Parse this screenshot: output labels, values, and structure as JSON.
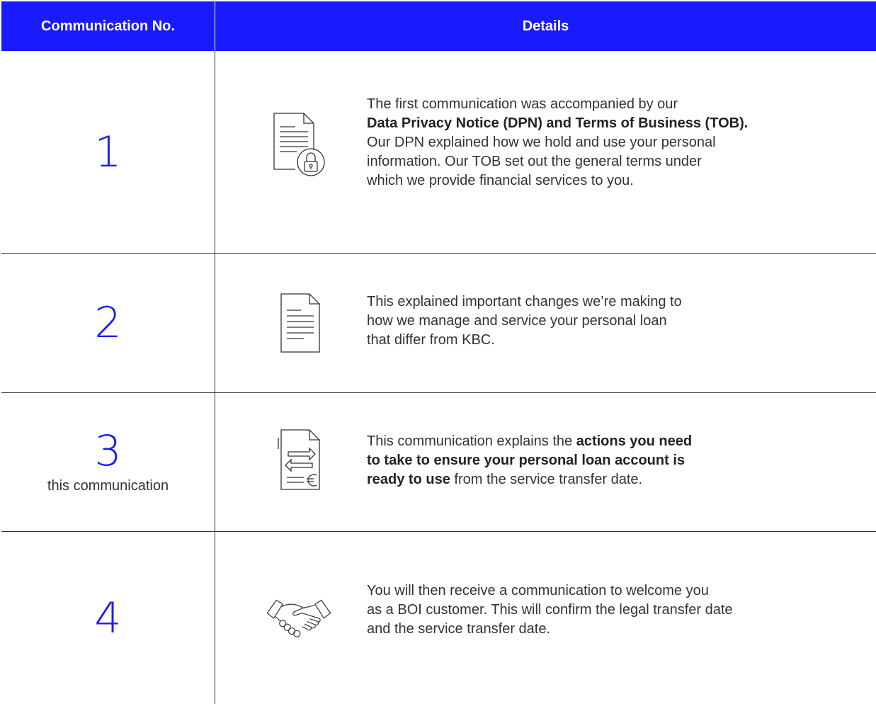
{
  "header": {
    "col_number": "Communication No.",
    "col_details": "Details"
  },
  "rows": [
    {
      "number": "1",
      "sub": "",
      "icon": "locked-document-icon",
      "lines": [
        {
          "t1": "The first communication was accompanied by our",
          "b": "",
          "t2": ""
        },
        {
          "t1": "",
          "b": "Data Privacy Notice (DPN) and Terms of Business (TOB).",
          "t2": ""
        },
        {
          "t1": "Our DPN explained how we hold and use your personal",
          "b": "",
          "t2": ""
        },
        {
          "t1": "information. Our TOB set out the general terms under",
          "b": "",
          "t2": ""
        },
        {
          "t1": "which we provide financial services to you.",
          "b": "",
          "t2": ""
        }
      ]
    },
    {
      "number": "2",
      "sub": "",
      "icon": "document-icon",
      "lines": [
        {
          "t1": "This explained important changes we’re making to",
          "b": "",
          "t2": ""
        },
        {
          "t1": "how we manage and service your personal loan",
          "b": "",
          "t2": ""
        },
        {
          "t1": "that differ from KBC.",
          "b": "",
          "t2": ""
        }
      ]
    },
    {
      "number": "3",
      "sub": "this communication",
      "icon": "transfer-document-icon",
      "lines": [
        {
          "t1": "This communication explains the ",
          "b": "actions you need",
          "t2": ""
        },
        {
          "t1": "",
          "b": "to take to ensure your personal loan account is",
          "t2": ""
        },
        {
          "t1": "",
          "b": "ready to use",
          "t2": " from the service transfer date."
        }
      ]
    },
    {
      "number": "4",
      "sub": "",
      "icon": "handshake-icon",
      "lines": [
        {
          "t1": "You will then receive a communication to welcome you",
          "b": "",
          "t2": ""
        },
        {
          "t1": "as a BOI customer. This will confirm the legal transfer date",
          "b": "",
          "t2": ""
        },
        {
          "t1": "and the service transfer date.",
          "b": "",
          "t2": ""
        }
      ]
    }
  ],
  "colors": {
    "accent": "#1a1aff",
    "text": "#333333",
    "border": "#333333"
  }
}
